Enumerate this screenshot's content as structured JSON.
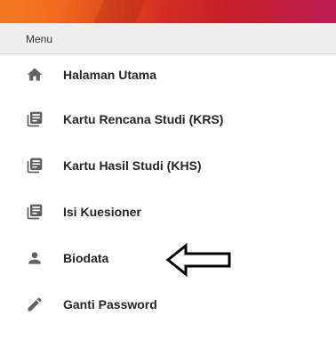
{
  "menu": {
    "header": "Menu",
    "items": [
      {
        "label": "Halaman Utama",
        "icon": "home-icon"
      },
      {
        "label": "Kartu Rencana Studi (KRS)",
        "icon": "document-list-icon"
      },
      {
        "label": "Kartu Hasil Studi (KHS)",
        "icon": "document-list-icon"
      },
      {
        "label": "Isi Kuesioner",
        "icon": "document-list-icon"
      },
      {
        "label": "Biodata",
        "icon": "person-icon"
      },
      {
        "label": "Ganti Password",
        "icon": "pencil-icon"
      }
    ]
  },
  "annotation": {
    "icon": "left-arrow-icon"
  },
  "colors": {
    "header_gradient_start": "#f47a22",
    "header_gradient_end": "#bd1e55",
    "menu_header_bg": "#eeeeee",
    "icon": "#616161",
    "text": "#262626"
  }
}
